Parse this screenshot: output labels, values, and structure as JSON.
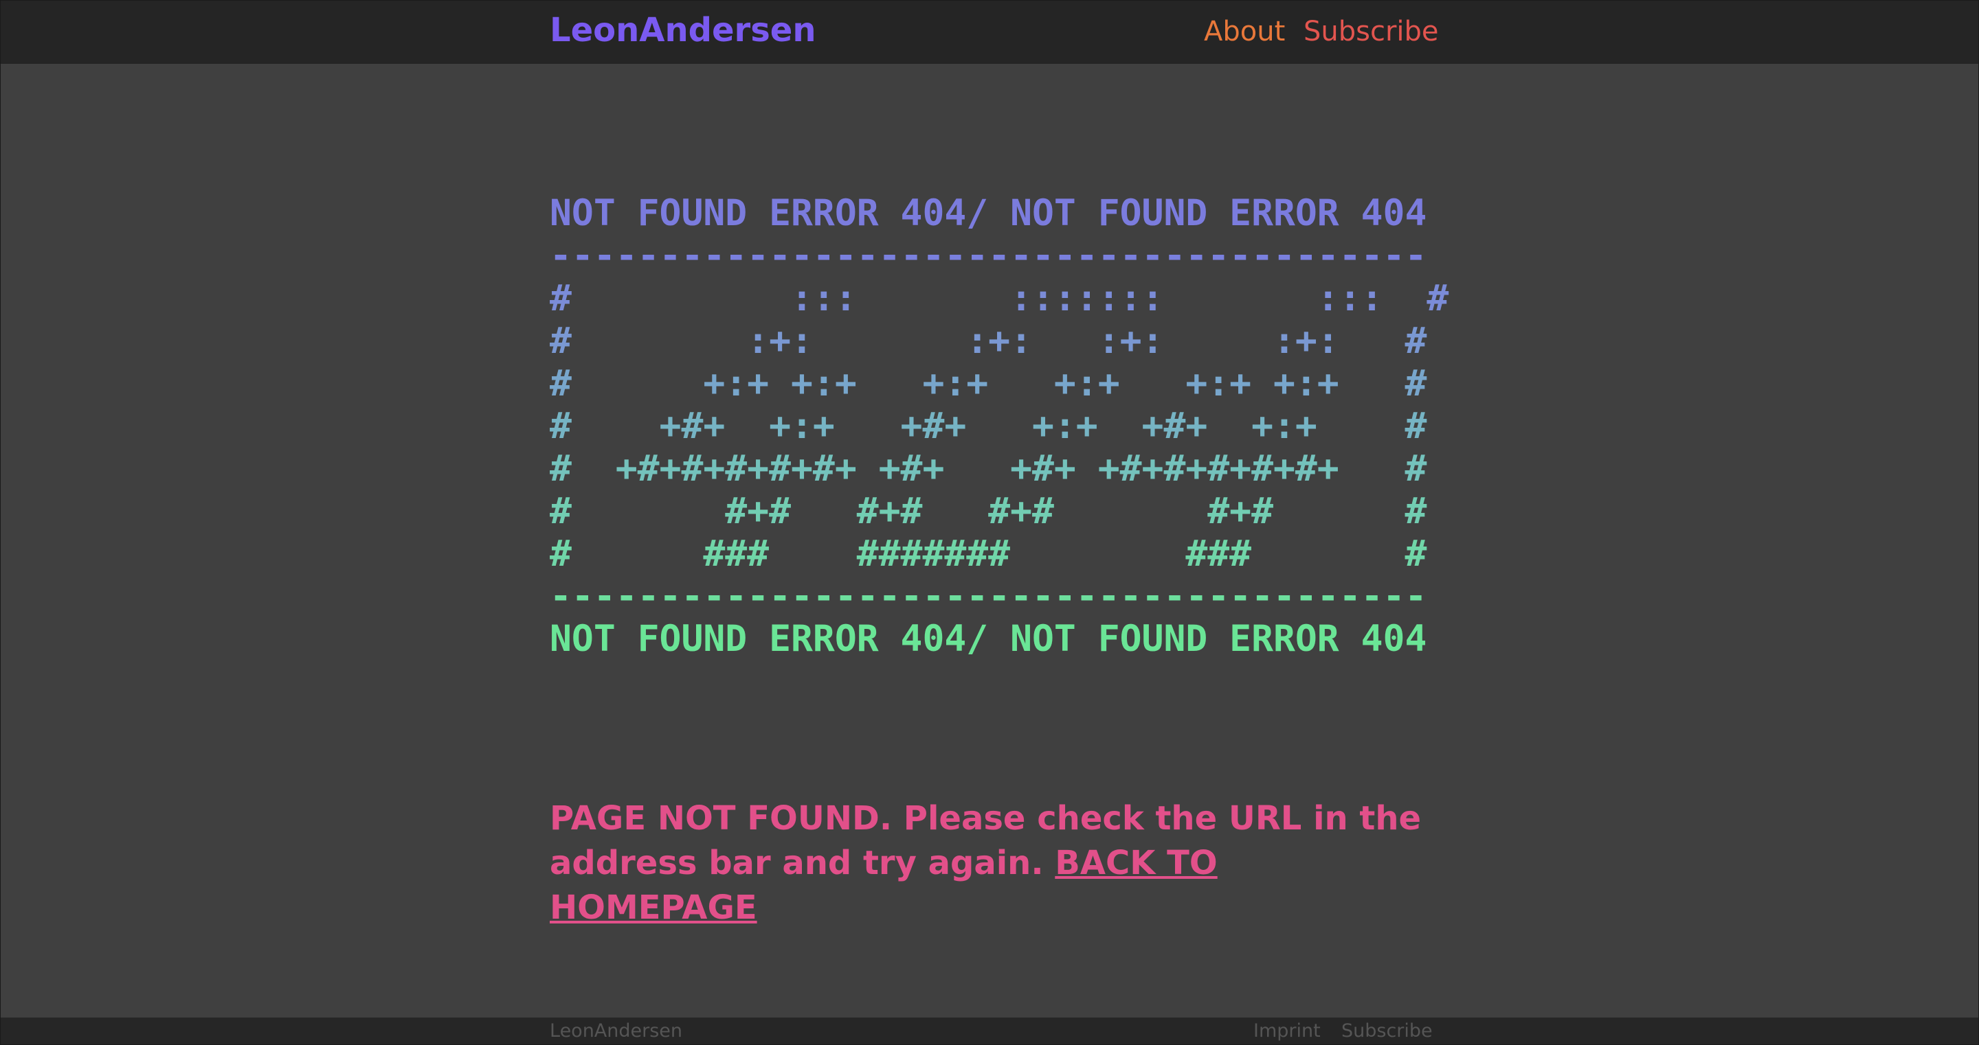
{
  "header": {
    "brand": "LeonAndersen",
    "nav": [
      {
        "label": "About"
      },
      {
        "label": "Subscribe"
      }
    ]
  },
  "ascii_art": {
    "lines": [
      "NOT FOUND ERROR 404/ NOT FOUND ERROR 404",
      "----------------------------------------",
      "#          :::       :::::::       :::  #",
      "#        :+:       :+:   :+:     :+:   #",
      "#      +:+ +:+   +:+   +:+   +:+ +:+   #",
      "#    +#+  +:+   +#+   +:+  +#+  +:+    #",
      "#  +#+#+#+#+#+ +#+   +#+ +#+#+#+#+#+   #",
      "#       #+#   #+#   #+#       #+#      #",
      "#      ###    #######        ###       #",
      "----------------------------------------",
      "NOT FOUND ERROR 404/ NOT FOUND ERROR 404"
    ],
    "colors": [
      "#7b7cde",
      "#7a80de",
      "#7b8cd8",
      "#7a98d2",
      "#78a6cc",
      "#76b4c4",
      "#74c2bc",
      "#72cdb2",
      "#70d6a8",
      "#6ddf9e",
      "#6ae596"
    ]
  },
  "message": {
    "text": "PAGE NOT FOUND. Please check the URL in the address bar and try again. ",
    "link": "BACK TO HOMEPAGE"
  },
  "footer": {
    "brand": "LeonAndersen",
    "links": [
      {
        "label": "Imprint"
      },
      {
        "label": "Subscribe"
      }
    ]
  },
  "colors": {
    "background": "#404040",
    "topbar": "#252525",
    "brand": "#7a5af0",
    "about": "#e9783a",
    "subscribe": "#e3554f",
    "message": "#e2508a"
  }
}
